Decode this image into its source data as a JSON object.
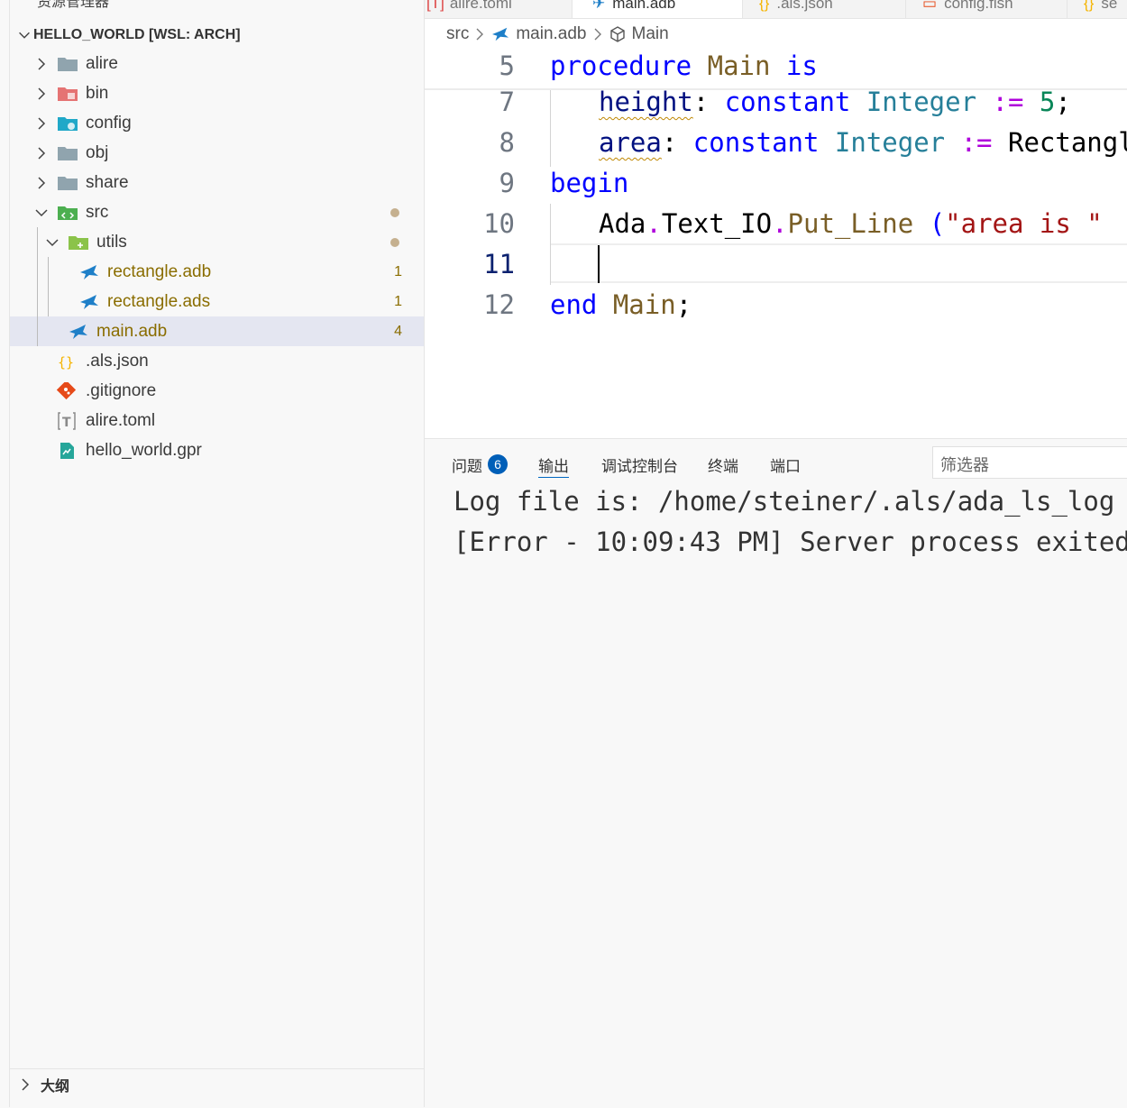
{
  "explorer": {
    "title": "资源管理器",
    "folder": "HELLO_WORLD [WSL: ARCH]",
    "items": [
      {
        "label": "alire",
        "icon": "folder-icon"
      },
      {
        "label": "bin",
        "icon": "folder-bin-icon"
      },
      {
        "label": "config",
        "icon": "folder-config-icon"
      },
      {
        "label": "obj",
        "icon": "folder-icon"
      },
      {
        "label": "share",
        "icon": "folder-icon"
      },
      {
        "label": "src",
        "icon": "folder-src-open-icon"
      },
      {
        "label": "utils",
        "icon": "folder-utils-open-icon"
      },
      {
        "label": "rectangle.adb",
        "icon": "ada-file-icon",
        "badge": "1"
      },
      {
        "label": "rectangle.ads",
        "icon": "ada-file-icon",
        "badge": "1"
      },
      {
        "label": "main.adb",
        "icon": "ada-file-icon",
        "badge": "4"
      },
      {
        "label": ".als.json",
        "icon": "json-file-icon"
      },
      {
        "label": ".gitignore",
        "icon": "git-file-icon"
      },
      {
        "label": "alire.toml",
        "icon": "toml-file-icon"
      },
      {
        "label": "hello_world.gpr",
        "icon": "gpr-file-icon"
      }
    ],
    "outline": "大纲"
  },
  "tabs": [
    {
      "label": "alire.toml"
    },
    {
      "label": "main.adb"
    },
    {
      "label": ".als.json"
    },
    {
      "label": "config.fish"
    },
    {
      "label": "se"
    }
  ],
  "breadcrumb": {
    "part1": "src",
    "part2": "main.adb",
    "part3": "Main"
  },
  "code": {
    "lines": [
      {
        "num": "5",
        "t1": "procedure",
        "t2": " ",
        "t3": "Main",
        "t4": " ",
        "t5": "is"
      },
      {
        "num": "7",
        "t1": "height",
        "t2": ":",
        "t3": " constant ",
        "t4": "Integer",
        "t5": " := ",
        "t6": "5",
        "t7": ";"
      },
      {
        "num": "8",
        "t1": "area",
        "t2": ":",
        "t3": " constant ",
        "t4": "Integer",
        "t5": " := ",
        "t6": "Rectangle"
      },
      {
        "num": "9",
        "t1": "begin"
      },
      {
        "num": "10",
        "t1": "Ada",
        "t2": ".",
        "t3": "Text_IO",
        "t4": ".",
        "t5": "Put_Line",
        "t6": " (",
        "t7": "\"area is \""
      },
      {
        "num": "11"
      },
      {
        "num": "12",
        "t1": "end",
        "t2": " Main",
        "t3": ";"
      }
    ]
  },
  "panel": {
    "tabs": [
      "问题",
      "输出",
      "调试控制台",
      "终端",
      "端口"
    ],
    "problems_count": "6",
    "filter_placeholder": "筛选器",
    "output": [
      "Log file is: /home/steiner/.als/ada_ls_log",
      "[Error - 10:09:43 PM] Server process exited"
    ]
  }
}
